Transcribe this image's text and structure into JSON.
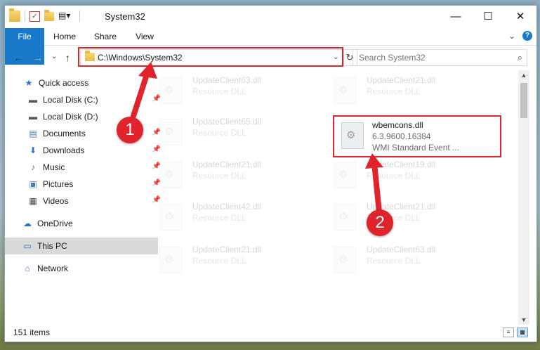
{
  "window": {
    "title": "System32"
  },
  "caption": {
    "minimize": "—",
    "maximize": "☐",
    "close": "✕"
  },
  "ribbon": {
    "tabs": [
      "File",
      "Home",
      "Share",
      "View"
    ],
    "expand": "⌄",
    "help": "?"
  },
  "nav": {
    "back": "←",
    "forward": "→",
    "recent": "⌄",
    "up": "↑"
  },
  "address": {
    "path": "C:\\Windows\\System32",
    "dropdown": "⌄",
    "refresh": "↻"
  },
  "search": {
    "placeholder": "Search System32",
    "icon": "⌕"
  },
  "sidebar": {
    "items": [
      {
        "label": "Quick access",
        "icon": "★",
        "pinned": false
      },
      {
        "label": "Local Disk (C:)",
        "icon": "▬",
        "pinned": true
      },
      {
        "label": "Local Disk (D:)",
        "icon": "▬",
        "pinned": false
      },
      {
        "label": "Documents",
        "icon": "▤",
        "pinned": true
      },
      {
        "label": "Downloads",
        "icon": "⬇",
        "pinned": true
      },
      {
        "label": "Music",
        "icon": "♪",
        "pinned": true
      },
      {
        "label": "Pictures",
        "icon": "▣",
        "pinned": true
      },
      {
        "label": "Videos",
        "icon": "▦",
        "pinned": true
      },
      {
        "label": "OneDrive",
        "icon": "☁",
        "pinned": false
      },
      {
        "label": "This PC",
        "icon": "▭",
        "pinned": false
      },
      {
        "label": "Network",
        "icon": "⌂",
        "pinned": false
      }
    ],
    "pin_icon": "📌"
  },
  "files": {
    "ghost": [
      {
        "name": "UpdateClient63.dll",
        "desc": "Resource DLL"
      },
      {
        "name": "UpdateClient21.dll",
        "desc": "Resource DLL"
      },
      {
        "name": "UpdateClient65.dll",
        "desc": "Resource DLL"
      },
      {
        "name": "UpdateClient21.dll",
        "desc": "Resource DLL"
      },
      {
        "name": "UpdateClient19.dll",
        "desc": "Resource DLL"
      },
      {
        "name": "UpdateClient42.dll",
        "desc": "Resource DLL"
      },
      {
        "name": "UpdateClient21.dll",
        "desc": "Resource DLL"
      },
      {
        "name": "UpdateClient21.dll",
        "desc": "Resource DLL"
      },
      {
        "name": "UpdateClient63.dll",
        "desc": "Resource DLL"
      }
    ],
    "highlight": {
      "name": "wbemcons.dll",
      "version": "6.3.9600.16384",
      "desc": "WMI Standard Event ..."
    }
  },
  "status": {
    "count": "151 items"
  },
  "annotations": {
    "step1": "1",
    "step2": "2"
  },
  "colors": {
    "accent": "#1979ca",
    "annotation": "#e0242c"
  }
}
